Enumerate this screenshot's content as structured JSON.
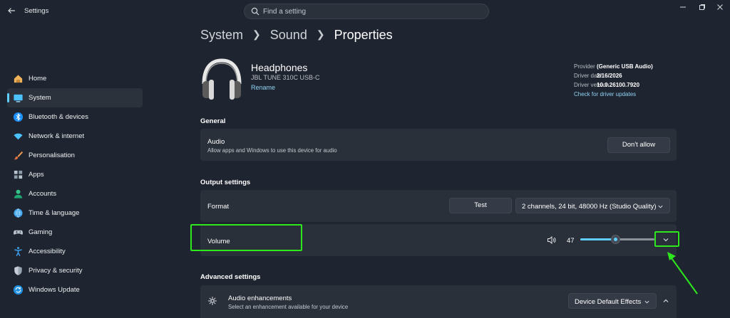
{
  "window": {
    "title": "Settings"
  },
  "search": {
    "placeholder": "Find a setting"
  },
  "sidebar": {
    "items": [
      {
        "label": "Home",
        "icon": "home-icon"
      },
      {
        "label": "System",
        "icon": "system-icon",
        "active": true
      },
      {
        "label": "Bluetooth & devices",
        "icon": "bluetooth-icon"
      },
      {
        "label": "Network & internet",
        "icon": "wifi-icon"
      },
      {
        "label": "Personalisation",
        "icon": "brush-icon"
      },
      {
        "label": "Apps",
        "icon": "apps-icon"
      },
      {
        "label": "Accounts",
        "icon": "person-icon"
      },
      {
        "label": "Time & language",
        "icon": "globe-icon"
      },
      {
        "label": "Gaming",
        "icon": "gamepad-icon"
      },
      {
        "label": "Accessibility",
        "icon": "accessibility-icon"
      },
      {
        "label": "Privacy & security",
        "icon": "shield-icon"
      },
      {
        "label": "Windows Update",
        "icon": "update-icon"
      }
    ]
  },
  "breadcrumb": {
    "items": [
      "System",
      "Sound",
      "Properties"
    ]
  },
  "device": {
    "name": "Headphones",
    "model": "JBL TUNE 310C USB-C",
    "rename_label": "Rename",
    "info": [
      {
        "key": "Provider",
        "value": "(Generic USB Audio)"
      },
      {
        "key": "Driver date",
        "value": "2/16/2026"
      },
      {
        "key": "Driver version",
        "value": "10.0.26100.7920"
      }
    ],
    "driver_link": "Check for driver updates"
  },
  "general": {
    "title": "General",
    "audio_title": "Audio",
    "audio_desc": "Allow apps and Windows to use this device for audio",
    "dont_allow_label": "Don't allow"
  },
  "output": {
    "title": "Output settings",
    "format_label": "Format",
    "test_label": "Test",
    "format_value": "2 channels, 24 bit, 48000 Hz (Studio Quality)",
    "volume_label": "Volume",
    "volume_value": "47",
    "volume_fraction": 0.47
  },
  "advanced": {
    "title": "Advanced settings",
    "enh_title": "Audio enhancements",
    "enh_desc": "Select an enhancement available for your device",
    "enh_value": "Device Default Effects"
  },
  "colors": {
    "accent": "#60cdff",
    "highlight": "#2ee81e",
    "background": "#1f2530",
    "card": "#2a303a"
  }
}
